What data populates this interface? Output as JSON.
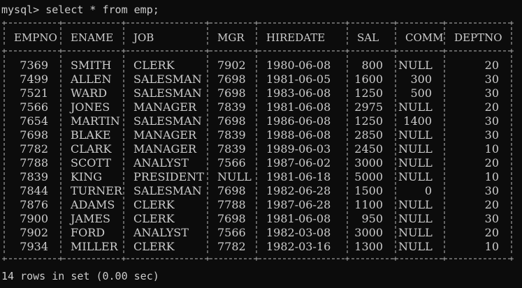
{
  "window": {
    "prompt_label": "mysql>",
    "command": "select * from emp;"
  },
  "table": {
    "columns": [
      "EMPNO",
      "ENAME",
      "JOB",
      "MGR",
      "HIREDATE",
      "SAL",
      "COMM",
      "DEPTNO"
    ],
    "rows": [
      [
        "7369",
        "SMITH",
        "CLERK",
        "7902",
        "1980-06-08",
        "800",
        "NULL",
        "20"
      ],
      [
        "7499",
        "ALLEN",
        "SALESMAN",
        "7698",
        "1981-06-05",
        "1600",
        "300",
        "30"
      ],
      [
        "7521",
        "WARD",
        "SALESMAN",
        "7698",
        "1983-06-08",
        "1250",
        "500",
        "30"
      ],
      [
        "7566",
        "JONES",
        "MANAGER",
        "7839",
        "1981-06-08",
        "2975",
        "NULL",
        "20"
      ],
      [
        "7654",
        "MARTIN",
        "SALESMAN",
        "7698",
        "1986-06-08",
        "1250",
        "1400",
        "30"
      ],
      [
        "7698",
        "BLAKE",
        "MANAGER",
        "7839",
        "1988-06-08",
        "2850",
        "NULL",
        "30"
      ],
      [
        "7782",
        "CLARK",
        "MANAGER",
        "7839",
        "1989-06-03",
        "2450",
        "NULL",
        "10"
      ],
      [
        "7788",
        "SCOTT",
        "ANALYST",
        "7566",
        "1987-06-02",
        "3000",
        "NULL",
        "20"
      ],
      [
        "7839",
        "KING",
        "PRESIDENT",
        "NULL",
        "1981-06-18",
        "5000",
        "NULL",
        "10"
      ],
      [
        "7844",
        "TURNER",
        "SALESMAN",
        "7698",
        "1982-06-28",
        "1500",
        "0",
        "30"
      ],
      [
        "7876",
        "ADAMS",
        "CLERK",
        "7788",
        "1987-06-28",
        "1100",
        "NULL",
        "20"
      ],
      [
        "7900",
        "JAMES",
        "CLERK",
        "7698",
        "1981-06-08",
        "950",
        "NULL",
        "30"
      ],
      [
        "7902",
        "FORD",
        "ANALYST",
        "7566",
        "1982-03-08",
        "3000",
        "NULL",
        "20"
      ],
      [
        "7934",
        "MILLER",
        "CLERK",
        "7782",
        "1982-03-16",
        "1300",
        "NULL",
        "10"
      ]
    ]
  },
  "status": {
    "summary": "14 rows in set (0.00 sec)"
  },
  "colors": {
    "background": "#0c0c0c",
    "text": "#cccccc",
    "border": "#bdbdbd"
  }
}
